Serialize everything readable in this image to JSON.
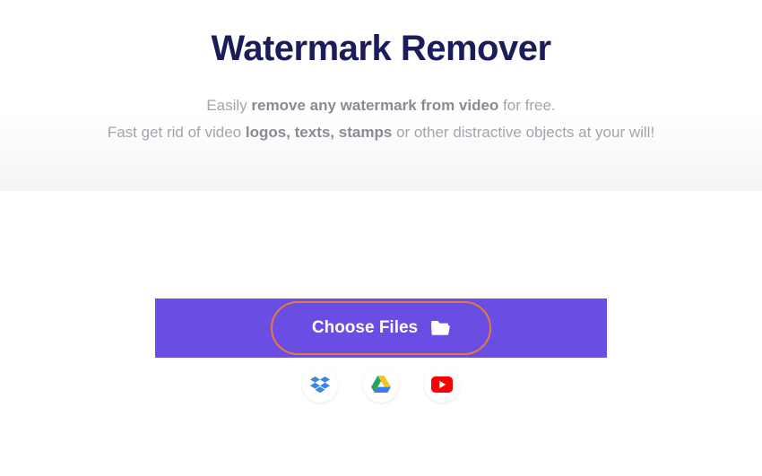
{
  "title": "Watermark Remover",
  "subtitle": {
    "line1_pre": "Easily ",
    "line1_bold": "remove any watermark from video",
    "line1_post": " for free.",
    "line2_pre": "Fast get rid of video ",
    "line2_bold": "logos, texts, stamps",
    "line2_post": " or other distractive objects at your will!"
  },
  "upload": {
    "button_label": "Choose Files",
    "sources": [
      "dropbox",
      "google-drive",
      "youtube"
    ]
  }
}
